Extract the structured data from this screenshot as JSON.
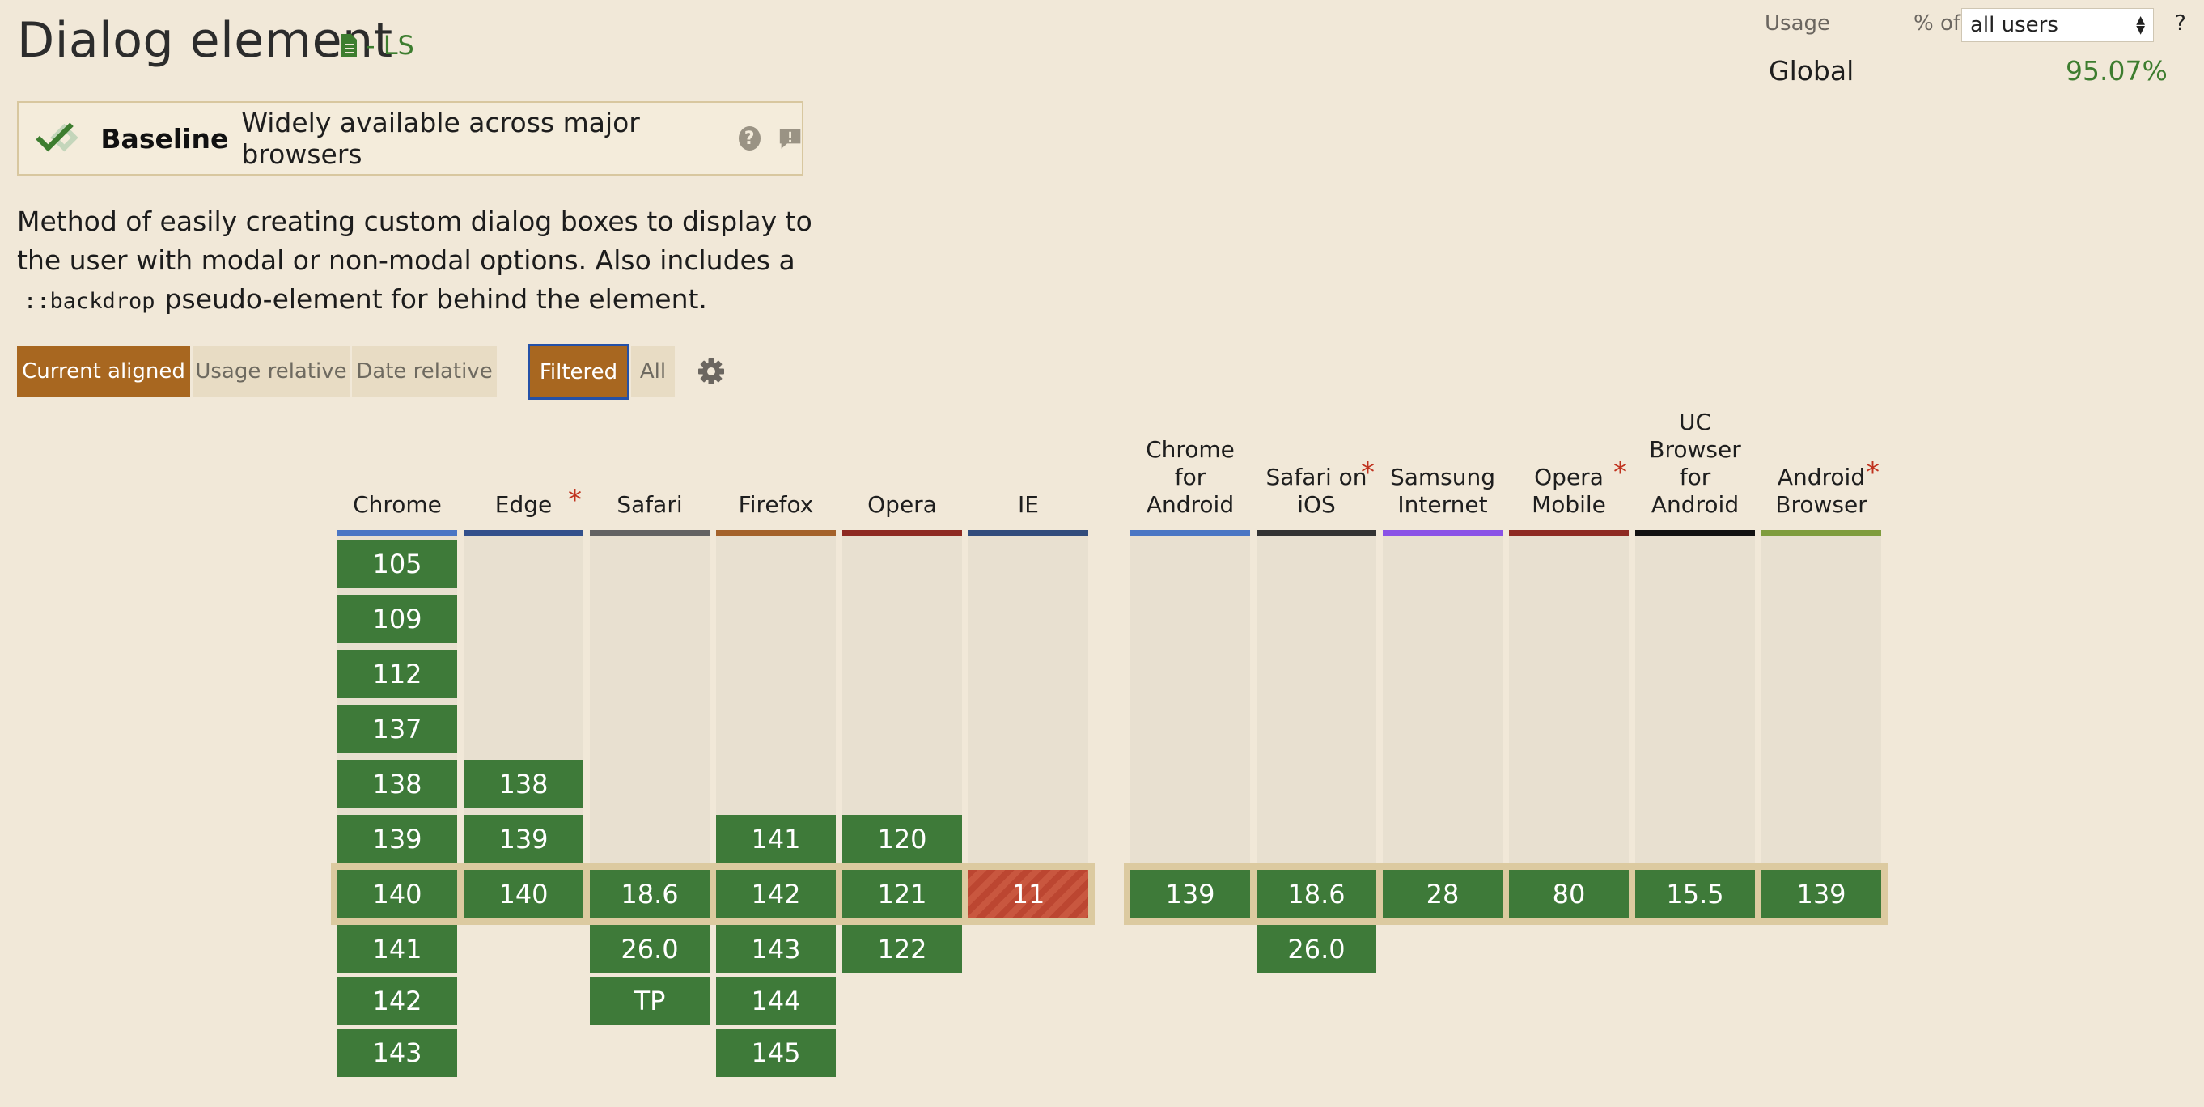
{
  "page": {
    "title": "Dialog element",
    "spec_status": "- LS",
    "baseline": {
      "label": "Baseline",
      "text": "Widely available across major browsers",
      "help": "?"
    },
    "description_pre": "Method of easily creating custom dialog boxes to display to the user with modal or non-modal options. Also includes a",
    "description_code": "::backdrop",
    "description_post": "pseudo-element for behind the element."
  },
  "view_buttons": {
    "current": "Current aligned",
    "usage": "Usage relative",
    "date": "Date relative",
    "filtered": "Filtered",
    "all": "All"
  },
  "usage": {
    "label": "Usage",
    "pct_of": "% of",
    "selected": "all users",
    "help": "?",
    "region": "Global",
    "value": "95.07%"
  },
  "colors": {
    "supported": "#3e7a39",
    "unsupported": "#bc4631",
    "accent": "#a86720",
    "text_green": "#3d7d2f"
  },
  "browsers": [
    {
      "name": "Chrome",
      "lines": [
        "Chrome"
      ],
      "bar": "#4a76c4",
      "star": false,
      "versions": [
        "105",
        "109",
        "112",
        "137",
        "138",
        "139"
      ],
      "current": "140",
      "future": [
        "141",
        "142",
        "143"
      ]
    },
    {
      "name": "Edge",
      "lines": [
        "Edge"
      ],
      "bar": "#33508b",
      "star": true,
      "versions": [
        "138",
        "139"
      ],
      "current": "140",
      "future": []
    },
    {
      "name": "Safari",
      "lines": [
        "Safari"
      ],
      "bar": "#636363",
      "star": false,
      "versions": [],
      "current": "18.6",
      "future": [
        "26.0",
        "TP"
      ]
    },
    {
      "name": "Firefox",
      "lines": [
        "Firefox"
      ],
      "bar": "#a4622a",
      "star": false,
      "versions": [
        "141"
      ],
      "current": "142",
      "future": [
        "143",
        "144",
        "145"
      ]
    },
    {
      "name": "Opera",
      "lines": [
        "Opera"
      ],
      "bar": "#8e2a22",
      "star": false,
      "versions": [
        "120"
      ],
      "current": "121",
      "future": [
        "122"
      ]
    },
    {
      "name": "IE",
      "lines": [
        "IE"
      ],
      "bar": "#324c7c",
      "star": false,
      "versions": [],
      "current": "11",
      "current_unsupported": true,
      "future": []
    },
    {
      "name": "Chrome for Android",
      "lines": [
        "Chrome",
        "for",
        "Android"
      ],
      "bar": "#4a76c4",
      "star": false,
      "versions": [],
      "current": "139",
      "future": []
    },
    {
      "name": "Safari on iOS",
      "lines": [
        "Safari on",
        "iOS"
      ],
      "bar": "#333333",
      "star": true,
      "versions": [],
      "current": "18.6",
      "future": [
        "26.0"
      ]
    },
    {
      "name": "Samsung Internet",
      "lines": [
        "Samsung",
        "Internet"
      ],
      "bar": "#8a52e6",
      "star": false,
      "versions": [],
      "current": "28",
      "future": []
    },
    {
      "name": "Opera Mobile",
      "lines": [
        "Opera",
        "Mobile"
      ],
      "bar": "#8e2a22",
      "star": true,
      "versions": [],
      "current": "80",
      "future": []
    },
    {
      "name": "UC Browser for Android",
      "lines": [
        "UC",
        "Browser",
        "for",
        "Android"
      ],
      "bar": "#111111",
      "star": false,
      "versions": [],
      "current": "15.5",
      "future": []
    },
    {
      "name": "Android Browser",
      "lines": [
        "Android",
        "Browser"
      ],
      "bar": "#7f9c3d",
      "star": true,
      "versions": [],
      "current": "139",
      "future": []
    }
  ]
}
